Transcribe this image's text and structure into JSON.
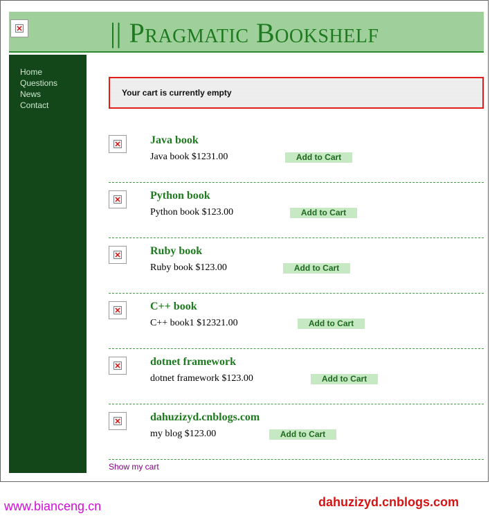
{
  "header": {
    "title": "|| Pragmatic Bookshelf",
    "logo_icon": "broken-image-icon"
  },
  "sidebar": {
    "items": [
      {
        "label": "Home"
      },
      {
        "label": "Questions"
      },
      {
        "label": "News"
      },
      {
        "label": "Contact"
      }
    ]
  },
  "cart_notice": "Your cart is currently empty",
  "products": [
    {
      "title": "Java book",
      "description": "Java book $1231.00",
      "button": "Add to Cart",
      "image_icon": "broken-image-icon"
    },
    {
      "title": "Python book",
      "description": "Python book $123.00",
      "button": "Add to Cart",
      "image_icon": "broken-image-icon"
    },
    {
      "title": "Ruby book",
      "description": "Ruby book $123.00",
      "button": "Add to Cart",
      "image_icon": "broken-image-icon"
    },
    {
      "title": "C++ book",
      "description": "C++ book1 $12321.00",
      "button": "Add to Cart",
      "image_icon": "broken-image-icon"
    },
    {
      "title": "dotnet framework",
      "description": "dotnet framework $123.00",
      "button": "Add to Cart",
      "image_icon": "broken-image-icon"
    },
    {
      "title": "dahuzizyd.cnblogs.com",
      "description": "my blog $123.00",
      "button": "Add to Cart",
      "image_icon": "broken-image-icon"
    }
  ],
  "show_cart_link": "Show my cart",
  "watermarks": {
    "left": "www.bianceng.cn",
    "right": "dahuzizyd.cnblogs.com"
  },
  "colors": {
    "header_bg": "#9fd09c",
    "sidebar_bg": "#13471a",
    "accent_green": "#1e7a1e",
    "notice_border": "#e31c1c",
    "button_bg": "#c6e8c3"
  }
}
